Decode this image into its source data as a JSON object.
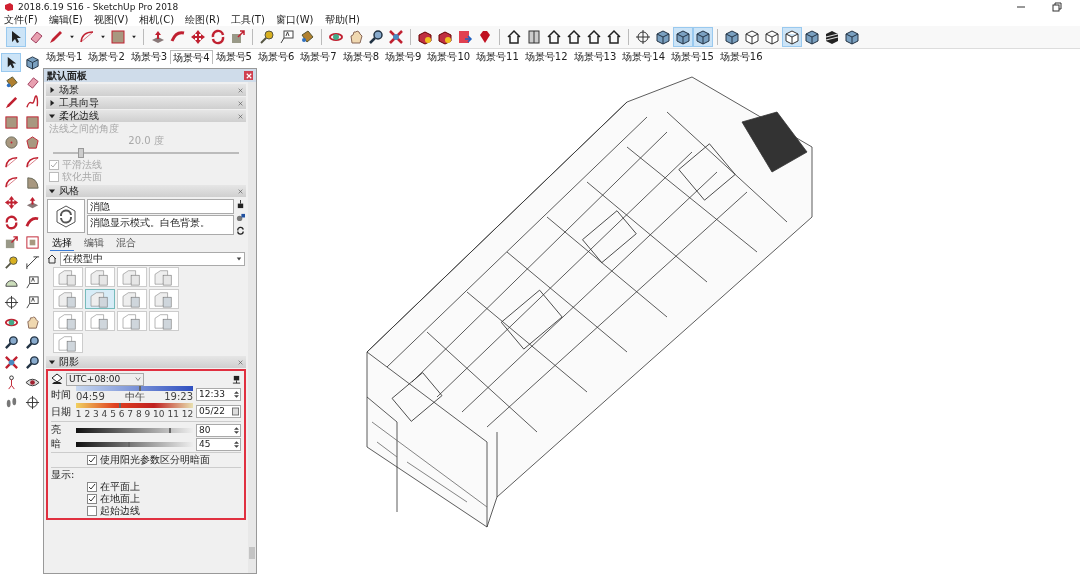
{
  "window": {
    "title": "2018.6.19 S16 - SketchUp Pro 2018"
  },
  "menu": [
    "文件(F)",
    "编辑(E)",
    "视图(V)",
    "相机(C)",
    "绘图(R)",
    "工具(T)",
    "窗口(W)",
    "帮助(H)"
  ],
  "toolbar": [
    {
      "kind": "select",
      "selected": true
    },
    {
      "kind": "eraser",
      "selected": false
    },
    {
      "kind": "pencil",
      "selected": false
    },
    {
      "kind": "caret",
      "selected": false
    },
    {
      "kind": "arc",
      "selected": false
    },
    {
      "kind": "caret",
      "selected": false
    },
    {
      "kind": "rect",
      "selected": false
    },
    {
      "kind": "caret",
      "selected": false
    },
    {
      "kind": "pushpull",
      "selected": false
    },
    {
      "kind": "followme",
      "selected": false
    },
    {
      "kind": "move",
      "selected": false
    },
    {
      "kind": "rotate",
      "selected": false
    },
    {
      "kind": "scale",
      "selected": false
    },
    {
      "kind": "tape",
      "selected": false
    },
    {
      "kind": "text",
      "selected": false
    },
    {
      "kind": "paint",
      "selected": false
    },
    {
      "kind": "orbit",
      "selected": false
    },
    {
      "kind": "pan",
      "selected": false
    },
    {
      "kind": "zoom",
      "selected": false
    },
    {
      "kind": "zoomext",
      "selected": false
    },
    {
      "kind": "warehouse",
      "selected": false
    },
    {
      "kind": "warehouse",
      "selected": false
    },
    {
      "kind": "extension",
      "selected": false
    },
    {
      "kind": "ruby",
      "selected": false
    },
    {
      "kind": "house",
      "selected": false
    },
    {
      "kind": "door",
      "selected": false
    },
    {
      "kind": "house",
      "selected": false
    },
    {
      "kind": "house",
      "selected": false
    },
    {
      "kind": "house",
      "selected": false
    },
    {
      "kind": "house",
      "selected": false
    },
    {
      "kind": "axes",
      "selected": false
    },
    {
      "kind": "cube",
      "selected": false
    },
    {
      "kind": "cube",
      "selected": true
    },
    {
      "kind": "cube",
      "selected": true
    },
    {
      "kind": "cube",
      "selected": false
    },
    {
      "kind": "wire",
      "selected": false
    },
    {
      "kind": "wire",
      "selected": false
    },
    {
      "kind": "wire",
      "selected": true
    },
    {
      "kind": "cube",
      "selected": false
    },
    {
      "kind": "stripes",
      "selected": false
    },
    {
      "kind": "cube",
      "selected": false
    }
  ],
  "scene_tabs": [
    {
      "label": "场景号1",
      "selected": false
    },
    {
      "label": "场景号2",
      "selected": false
    },
    {
      "label": "场景号3",
      "selected": false
    },
    {
      "label": "场景号4",
      "selected": true
    },
    {
      "label": "场景号5",
      "selected": false
    },
    {
      "label": "场景号6",
      "selected": false
    },
    {
      "label": "场景号7",
      "selected": false
    },
    {
      "label": "场景号8",
      "selected": false
    },
    {
      "label": "场景号9",
      "selected": false
    },
    {
      "label": "场景号10",
      "selected": false
    },
    {
      "label": "场景号11",
      "selected": false
    },
    {
      "label": "场景号12",
      "selected": false
    },
    {
      "label": "场景号13",
      "selected": false
    },
    {
      "label": "场景号14",
      "selected": false
    },
    {
      "label": "场景号15",
      "selected": false
    },
    {
      "label": "场景号16",
      "selected": false
    }
  ],
  "tool_palette": [
    {
      "kind": "select",
      "selected": true
    },
    {
      "kind": "cube",
      "selected": false
    },
    {
      "kind": "paint",
      "selected": false
    },
    {
      "kind": "eraser",
      "selected": false
    },
    {
      "kind": "pencil",
      "selected": false
    },
    {
      "kind": "freehand",
      "selected": false
    },
    {
      "kind": "rect",
      "selected": false
    },
    {
      "kind": "rect",
      "selected": false
    },
    {
      "kind": "circle",
      "selected": false
    },
    {
      "kind": "polygon",
      "selected": false
    },
    {
      "kind": "arc",
      "selected": false
    },
    {
      "kind": "arc",
      "selected": false
    },
    {
      "kind": "arc",
      "selected": false
    },
    {
      "kind": "pie",
      "selected": false
    },
    {
      "kind": "move",
      "selected": false
    },
    {
      "kind": "pushpull",
      "selected": false
    },
    {
      "kind": "rotate",
      "selected": false
    },
    {
      "kind": "followme",
      "selected": false
    },
    {
      "kind": "scale",
      "selected": false
    },
    {
      "kind": "offset",
      "selected": false
    },
    {
      "kind": "tape",
      "selected": false
    },
    {
      "kind": "dimension",
      "selected": false
    },
    {
      "kind": "protractor",
      "selected": false
    },
    {
      "kind": "text",
      "selected": false
    },
    {
      "kind": "axes",
      "selected": false
    },
    {
      "kind": "text",
      "selected": false
    },
    {
      "kind": "orbit",
      "selected": false
    },
    {
      "kind": "pan",
      "selected": false
    },
    {
      "kind": "zoom",
      "selected": false
    },
    {
      "kind": "zoom",
      "selected": false
    },
    {
      "kind": "zoomext",
      "selected": false
    },
    {
      "kind": "zoom",
      "selected": false
    },
    {
      "kind": "walk",
      "selected": false
    },
    {
      "kind": "eye",
      "selected": false
    },
    {
      "kind": "footprints",
      "selected": false
    },
    {
      "kind": "axes",
      "selected": false
    }
  ],
  "tray": {
    "title": "默认面板",
    "sections": [
      {
        "title": "场景",
        "expanded": false
      },
      {
        "title": "工具向导",
        "expanded": false
      },
      {
        "kind": "soften",
        "title": "柔化边线",
        "expanded": true,
        "disabled": true,
        "angle_label": "法线之间的角度",
        "angle_value": "20.0 度",
        "level": 0.15,
        "checks": [
          {
            "label": "平滑法线",
            "checked": true
          },
          {
            "label": "软化共面",
            "checked": false
          }
        ]
      },
      {
        "kind": "styles",
        "title": "风格",
        "expanded": true,
        "style_name": "消隐",
        "style_description": "消隐显示模式。白色背景。",
        "tabs": [
          {
            "label": "选择",
            "selected": true
          },
          {
            "label": "编辑",
            "selected": false
          },
          {
            "label": "混合",
            "selected": false
          }
        ],
        "collection": "在模型中",
        "thumbnails": [
          {
            "selected": false
          },
          {
            "selected": false
          },
          {
            "selected": false
          },
          {
            "selected": false
          },
          {
            "selected": false
          },
          {
            "selected": true
          },
          {
            "selected": false
          },
          {
            "selected": false
          },
          {
            "selected": false
          },
          {
            "selected": false
          },
          {
            "selected": false
          },
          {
            "selected": false
          },
          {
            "selected": false
          }
        ]
      },
      {
        "kind": "shadows",
        "title": "阴影",
        "expanded": true,
        "highlighted": true,
        "timezone": "UTC+08:00",
        "time": {
          "label": "时间",
          "start": "04:59",
          "mid": "中午",
          "end": "19:23",
          "level": 0.55,
          "value": "12:33"
        },
        "date": {
          "label": "日期",
          "months": "1 2 3 4 5 6 7 8 9 10 11 12",
          "level": 0.38,
          "value": "05/22"
        },
        "light": {
          "label": "亮",
          "level": 0.8,
          "value": "80"
        },
        "dark": {
          "label": "暗",
          "level": 0.45,
          "value": "45"
        },
        "use_sun": {
          "label": "使用阳光参数区分明暗面",
          "checked": true
        },
        "display_label": "显示:",
        "display": [
          {
            "label": "在平面上",
            "checked": true
          },
          {
            "label": "在地面上",
            "checked": true
          },
          {
            "label": "起始边线",
            "checked": false
          }
        ]
      }
    ]
  }
}
